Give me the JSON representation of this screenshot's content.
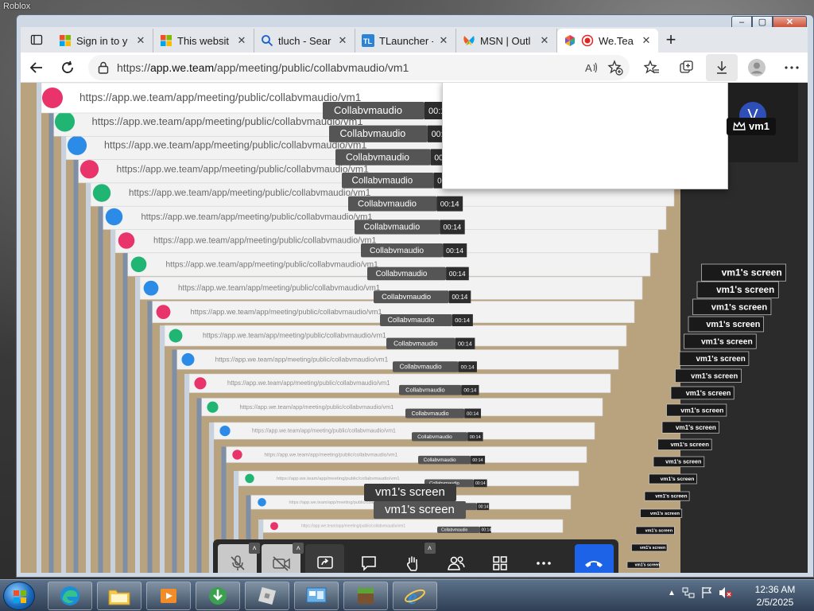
{
  "desktop": {
    "label": "Roblox"
  },
  "window": {
    "caption_buttons": [
      "min",
      "max",
      "close"
    ]
  },
  "browser": {
    "tabs": [
      {
        "label": "Sign in to y",
        "favicon": "windows-logo-icon",
        "active": false
      },
      {
        "label": "This websit",
        "favicon": "windows-logo-icon",
        "active": false
      },
      {
        "label": "tluch - Sear",
        "favicon": "search-icon",
        "active": false
      },
      {
        "label": "TLauncher -",
        "favicon": "tlauncher-icon",
        "active": false
      },
      {
        "label": "MSN | Outl",
        "favicon": "msn-butterfly-icon",
        "active": false
      },
      {
        "label": "We.Tea",
        "favicon": "weteam-logo-icon",
        "active": true,
        "recording": true
      }
    ],
    "url": {
      "scheme": "https://",
      "host": "app.we.team",
      "path": "/app/meeting/public/collabvmaudio/vm1"
    }
  },
  "meeting": {
    "room_name": "Collabvmaudio",
    "timer": "00:14",
    "timer_outer": "00:1",
    "avatar_letter": "V",
    "host_name": "vm1",
    "screen_tag": "vm1's screen",
    "controls": [
      {
        "name": "mic-off",
        "state": "off",
        "has_menu": true
      },
      {
        "name": "camera-off",
        "state": "off",
        "has_menu": true
      },
      {
        "name": "share-screen",
        "state": "active",
        "has_menu": false
      },
      {
        "name": "chat",
        "state": "normal",
        "has_menu": false
      },
      {
        "name": "raise-hand",
        "state": "normal",
        "has_menu": true
      },
      {
        "name": "participants",
        "state": "normal",
        "has_menu": false
      },
      {
        "name": "grid-view",
        "state": "normal",
        "has_menu": false
      },
      {
        "name": "more",
        "state": "normal",
        "has_menu": false
      },
      {
        "name": "hang-up",
        "state": "danger",
        "has_menu": false
      }
    ]
  },
  "taskbar": {
    "apps": [
      "edge-icon",
      "file-explorer-icon",
      "media-player-icon",
      "download-manager-icon",
      "roblox-icon",
      "control-panel-icon",
      "minecraft-icon",
      "internet-explorer-icon"
    ],
    "time": "12:36 AM",
    "date": "2/5/2025"
  },
  "colors": {
    "accent": "#1d63e8",
    "record": "#e02424",
    "taskbar": "#2f3f55"
  }
}
